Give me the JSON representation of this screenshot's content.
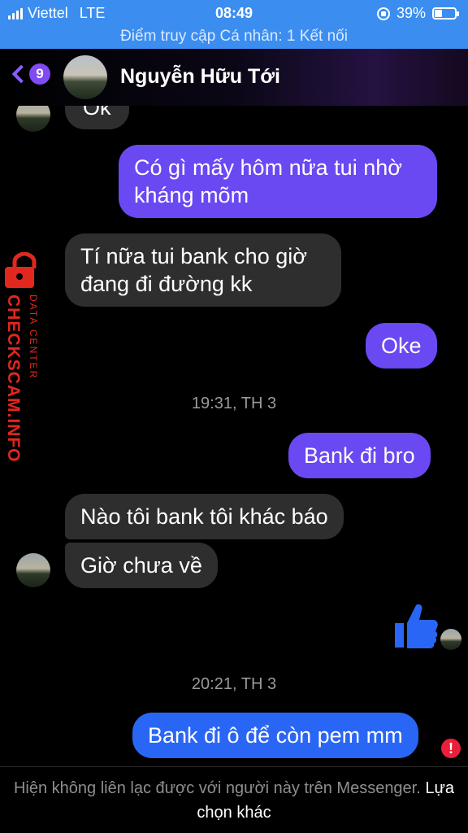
{
  "status_bar": {
    "carrier": "Viettel",
    "network": "LTE",
    "time": "08:49",
    "battery_percent": "39%",
    "battery_level": 0.39
  },
  "hotspot_banner": "Điểm truy cập Cá nhân: 1 Kết nối",
  "header": {
    "back_badge": "9",
    "contact_name": "Nguyễn Hữu Tới"
  },
  "messages": [
    {
      "side": "in",
      "text": "Ok"
    },
    {
      "side": "out",
      "text": "Có gì mấy hôm nữa tui nhờ kháng mõm"
    },
    {
      "side": "in",
      "text": "Tí nữa tui bank cho giờ đang đi đường kk"
    },
    {
      "side": "out",
      "text": "Oke"
    },
    {
      "side": "timestamp",
      "text": "19:31, TH 3"
    },
    {
      "side": "out",
      "text": "Bank đi bro"
    },
    {
      "side": "in",
      "text": "Nào tôi bank tôi khác báo"
    },
    {
      "side": "in",
      "text": "Giờ chưa về"
    },
    {
      "side": "out",
      "type": "like",
      "icon": "thumbs-up-icon"
    },
    {
      "side": "timestamp",
      "text": "20:21, TH 3"
    },
    {
      "side": "out",
      "text": "Bank đi ô để còn pem mm",
      "status": "error"
    }
  ],
  "watermark": {
    "main": "CHECKSCAM.INFO",
    "sub": "DATA CENTER"
  },
  "footer": {
    "notice": "Hiện không liên lạc được với người này trên Messenger.",
    "link": "Lựa chọn khác"
  },
  "colors": {
    "status_bar": "#3b8ef0",
    "outgoing_purple": "#6a48f2",
    "outgoing_blue": "#2a66f5",
    "incoming": "#2e2e2e",
    "watermark": "#e0281e",
    "error": "#e8203a"
  }
}
